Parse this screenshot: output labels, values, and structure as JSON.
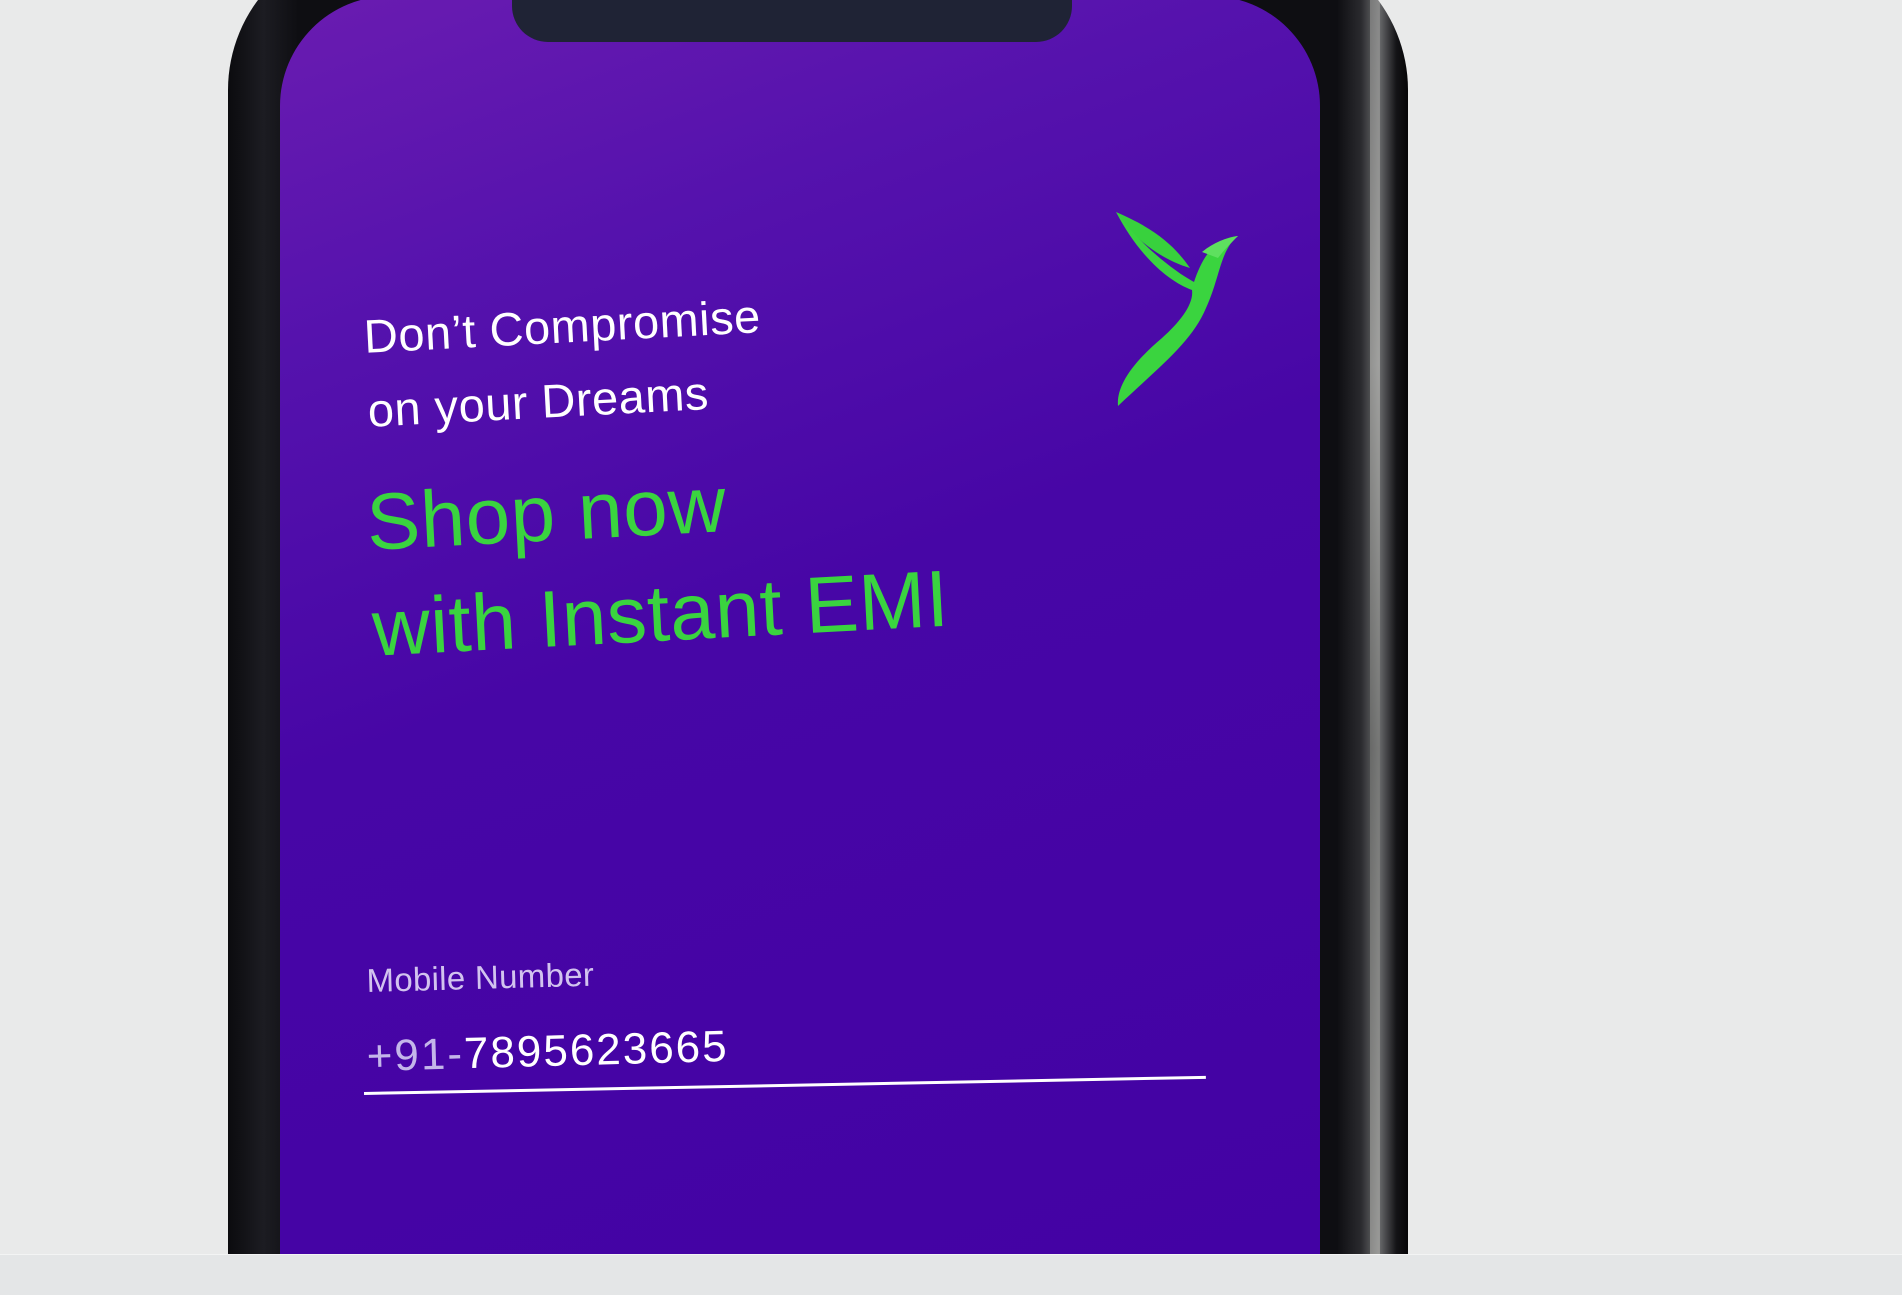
{
  "app": {
    "tagline_line1": "Don’t Compromise",
    "tagline_line2": "on your Dreams",
    "headline_line1": "Shop now",
    "headline_line2": "with Instant EMI",
    "logo_icon": "bird-icon"
  },
  "mobile_field": {
    "label": "Mobile Number",
    "prefix": "+91-",
    "value": "7895623665"
  },
  "colors": {
    "screen_purple": "#4706a6",
    "accent_green": "#3ad43f",
    "text_white": "#ffffff",
    "background": "#e9eaea"
  }
}
